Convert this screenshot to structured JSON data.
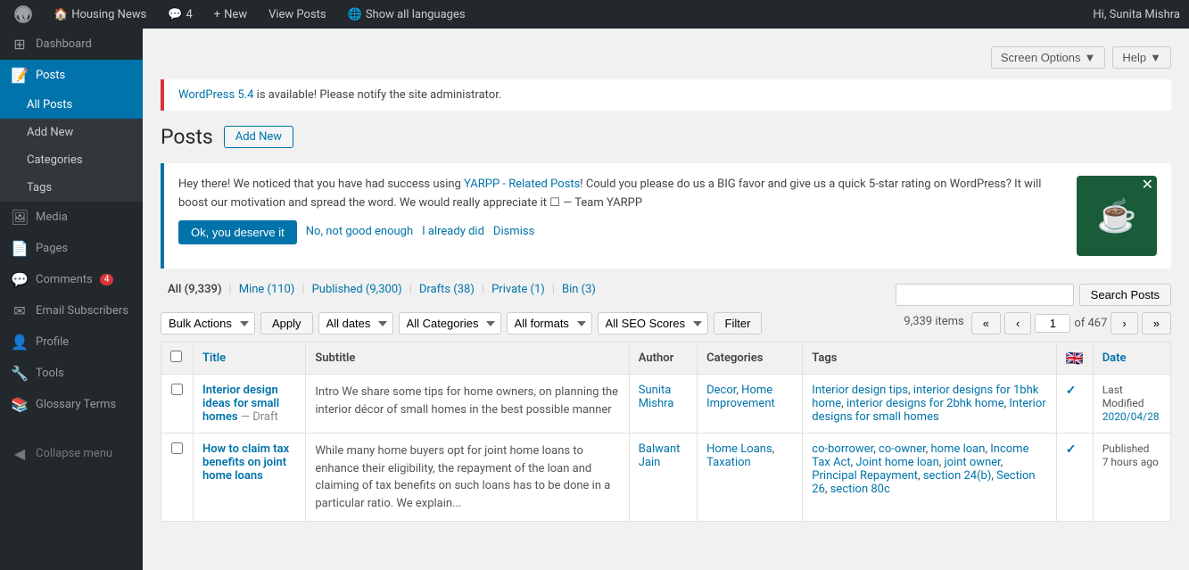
{
  "adminbar": {
    "site_name": "Housing News",
    "notification_count": "4",
    "new_label": "New",
    "view_posts_label": "View Posts",
    "show_all_languages_label": "Show all languages",
    "user_greeting": "Hi, Sunita Mishra"
  },
  "top_buttons": {
    "screen_options": "Screen Options",
    "help": "Help"
  },
  "notice": {
    "link_text": "WordPress 5.4",
    "message": " is available! Please notify the site administrator."
  },
  "page_header": {
    "title": "Posts",
    "add_new": "Add New"
  },
  "yarpp": {
    "text_before_link": "Hey there! We noticed that you have had success using ",
    "link_text": "YARPP - Related Posts",
    "text_after_link": "! Could you please do us a BIG favor and give us a quick 5-star rating on WordPress? It will boost our motivation and spread the word. We would really appreciate it ☐ — Team YARPP",
    "btn_ok": "Ok, you deserve it",
    "btn_no": "No, not good enough",
    "btn_did": "I already did",
    "btn_dismiss": "Dismiss"
  },
  "status_links": {
    "all_label": "All",
    "all_count": "9,339",
    "mine_label": "Mine",
    "mine_count": "110",
    "published_label": "Published",
    "published_count": "9,300",
    "drafts_label": "Drafts",
    "drafts_count": "38",
    "private_label": "Private",
    "private_count": "1",
    "bin_label": "Bin",
    "bin_count": "3"
  },
  "search": {
    "placeholder": "",
    "button": "Search Posts"
  },
  "filters": {
    "bulk_actions_label": "Bulk Actions",
    "apply_label": "Apply",
    "all_dates": "All dates",
    "all_categories": "All Categories",
    "all_formats": "All formats",
    "all_seo_scores": "All SEO Scores",
    "filter_label": "Filter"
  },
  "pagination": {
    "items_label": "9,339 items",
    "current_page": "1",
    "total_pages": "of 467"
  },
  "table": {
    "headers": {
      "checkbox": "",
      "title": "Title",
      "subtitle": "Subtitle",
      "author": "Author",
      "categories": "Categories",
      "tags": "Tags",
      "flag": "🇬🇧",
      "date": "Date"
    },
    "rows": [
      {
        "id": 1,
        "title": "Interior design ideas for small homes",
        "draft": "— Draft",
        "subtitle": "Intro We share some tips for home owners, on planning the interior décor of small homes in the best possible manner",
        "author": "Sunita Mishra",
        "categories": [
          "Decor",
          "Home Improvement"
        ],
        "tags": [
          "Interior design tips",
          "interior designs for 1bhk home",
          "interior designs for 2bhk home",
          "Interior designs for small homes"
        ],
        "has_flag": true,
        "date_type": "Last Modified",
        "date_value": "2020/04/28"
      },
      {
        "id": 2,
        "title": "How to claim tax benefits on joint home loans",
        "draft": "",
        "subtitle": "While many home buyers opt for joint home loans to enhance their eligibility, the repayment of the loan and claiming of tax benefits on such loans has to be done in a particular ratio. We explain...",
        "author": "Balwant Jain",
        "categories": [
          "Home Loans",
          "Taxation"
        ],
        "tags": [
          "co-borrower",
          "co-owner",
          "home loan",
          "Income Tax Act",
          "Joint home loan",
          "joint owner",
          "Principal Repayment",
          "section 24(b)",
          "Section 26",
          "section 80c"
        ],
        "has_flag": true,
        "date_type": "Published",
        "date_value": "7 hours ago"
      }
    ]
  },
  "sidebar": {
    "dashboard": "Dashboard",
    "posts": "Posts",
    "posts_sub": {
      "all_posts": "All Posts",
      "add_new": "Add New",
      "categories": "Categories",
      "tags": "Tags"
    },
    "media": "Media",
    "pages": "Pages",
    "comments": "Comments",
    "comments_badge": "4",
    "email_subscribers": "Email Subscribers",
    "profile": "Profile",
    "tools": "Tools",
    "glossary_terms": "Glossary Terms",
    "collapse_menu": "Collapse menu"
  }
}
